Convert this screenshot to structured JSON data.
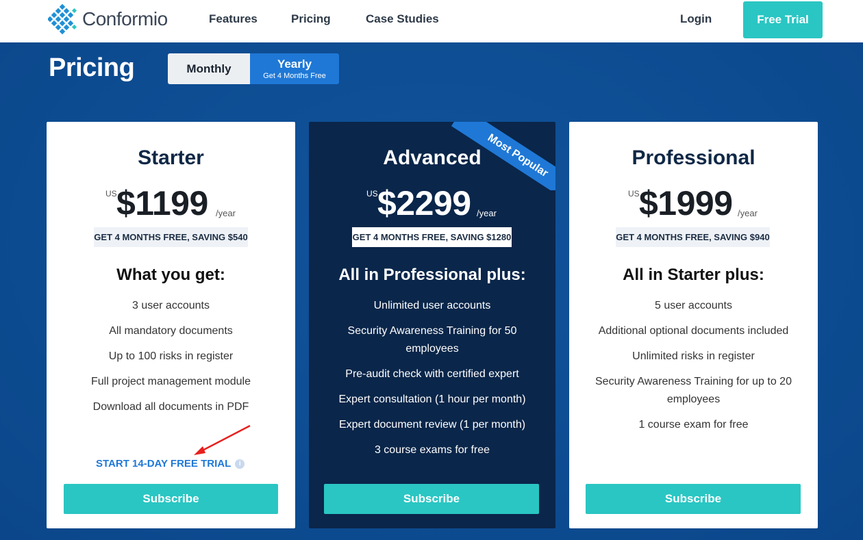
{
  "header": {
    "logo_text": "Conformio",
    "nav": [
      "Features",
      "Pricing",
      "Case Studies"
    ],
    "login": "Login",
    "free_trial": "Free Trial",
    "accent": "#2ac6c3"
  },
  "pricing": {
    "title": "Pricing",
    "toggle": {
      "monthly": "Monthly",
      "yearly": "Yearly",
      "yearly_note": "Get 4 Months Free",
      "selected": "Yearly"
    }
  },
  "plans": [
    {
      "name": "Starter",
      "currency": "US",
      "price": "$1199",
      "period": "/year",
      "savings": "GET 4 MONTHS FREE, SAVING $540",
      "features_title": "What you get:",
      "features": [
        "3 user accounts",
        "All mandatory documents",
        "Up to 100 risks in register",
        "Full project management module",
        "Download all documents in PDF"
      ],
      "trial_link": "START 14-DAY FREE TRIAL",
      "subscribe": "Subscribe"
    },
    {
      "name": "Advanced",
      "ribbon": "Most Popular",
      "currency": "US",
      "price": "$2299",
      "period": "/year",
      "savings": "GET 4 MONTHS FREE, SAVING $1280",
      "features_title": "All in Professional plus:",
      "features": [
        "Unlimited user accounts",
        "Security Awareness Training for 50 employees",
        "Pre-audit check with certified expert",
        "Expert consultation (1 hour per month)",
        "Expert document review (1 per month)",
        "3 course exams for free"
      ],
      "subscribe": "Subscribe"
    },
    {
      "name": "Professional",
      "currency": "US",
      "price": "$1999",
      "period": "/year",
      "savings": "GET 4 MONTHS FREE, SAVING $940",
      "features_title": "All in Starter plus:",
      "features": [
        "5 user accounts",
        "Additional optional documents included",
        "Unlimited risks in register",
        "Security Awareness Training for up to 20 employees",
        "1 course exam for free"
      ],
      "subscribe": "Subscribe"
    }
  ]
}
